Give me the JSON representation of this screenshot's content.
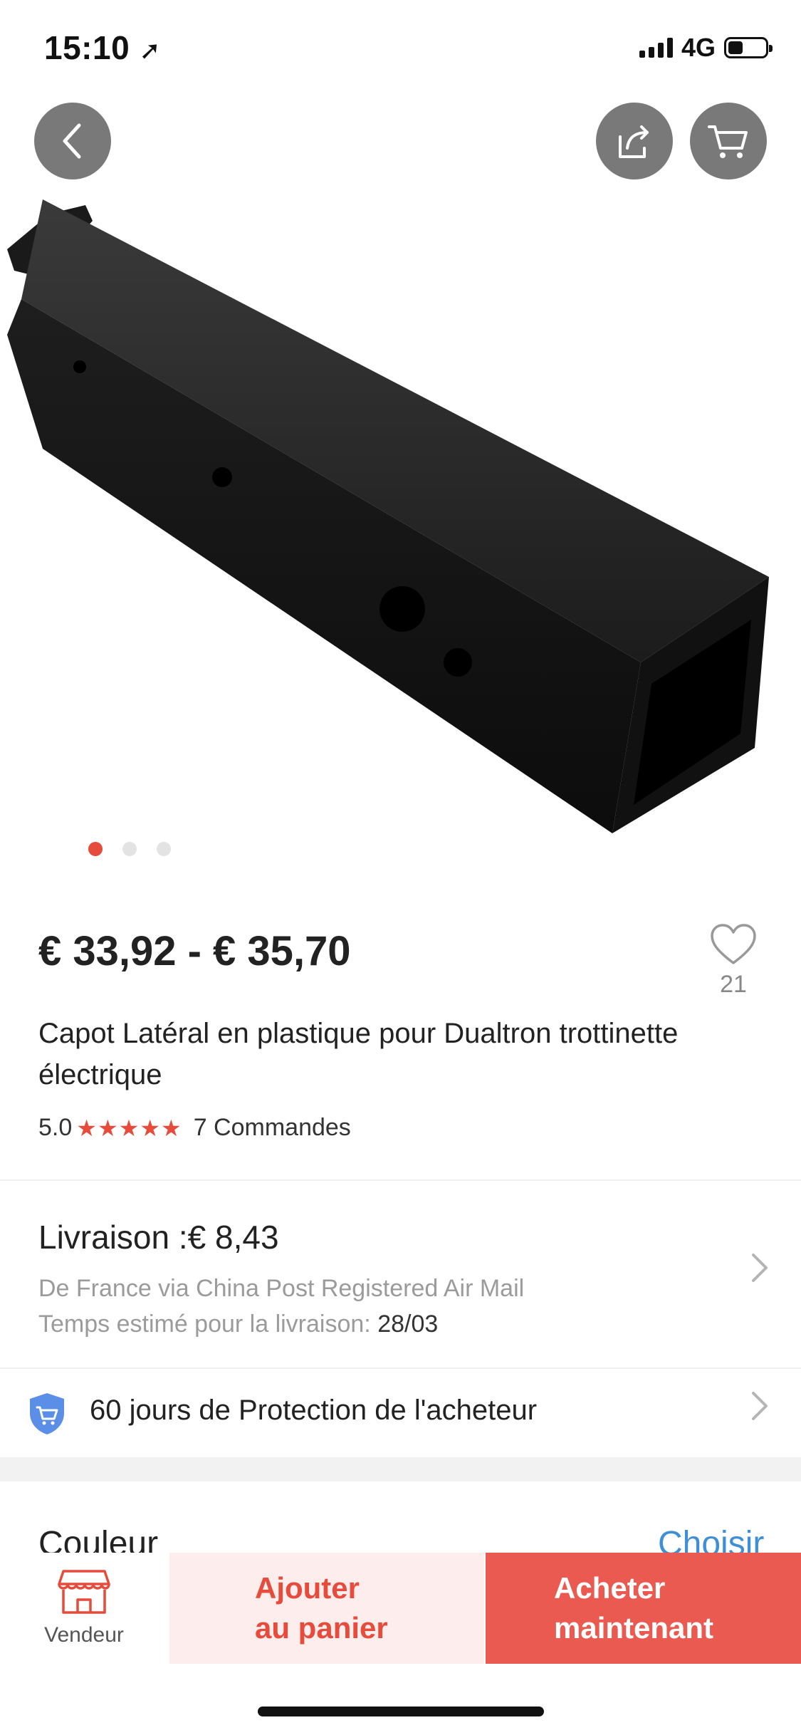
{
  "status_bar": {
    "time": "15:10",
    "network": "4G",
    "battery_level": 0.35
  },
  "header": {
    "back_icon": "chevron-left-icon",
    "share_icon": "share-icon",
    "cart_icon": "cart-icon"
  },
  "carousel": {
    "total": 3,
    "active": 0
  },
  "product": {
    "price": "€ 33,92 - € 35,70",
    "wishlist_count": "21",
    "title": "Capot Latéral en plastique pour Dualtron trottinette électrique",
    "rating": "5.0",
    "stars": "★★★★★",
    "orders": "7 Commandes"
  },
  "shipping": {
    "title": "Livraison :€ 8,43",
    "route": "De France via China Post Registered Air Mail",
    "eta_label": "Temps estimé pour la livraison:",
    "eta_date": "28/03"
  },
  "protection": {
    "text": "60 jours de Protection de l'acheteur"
  },
  "options": {
    "color_label": "Couleur",
    "choose_label": "Choisir"
  },
  "bottom_bar": {
    "seller_label": "Vendeur",
    "add_to_cart": "Ajouter\nau panier",
    "buy_now": "Acheter\nmaintenant"
  },
  "colors": {
    "accent": "#e64b3c",
    "buy_button": "#ea5a50",
    "add_button_bg": "#fdeeed",
    "link": "#3f8fd8"
  }
}
